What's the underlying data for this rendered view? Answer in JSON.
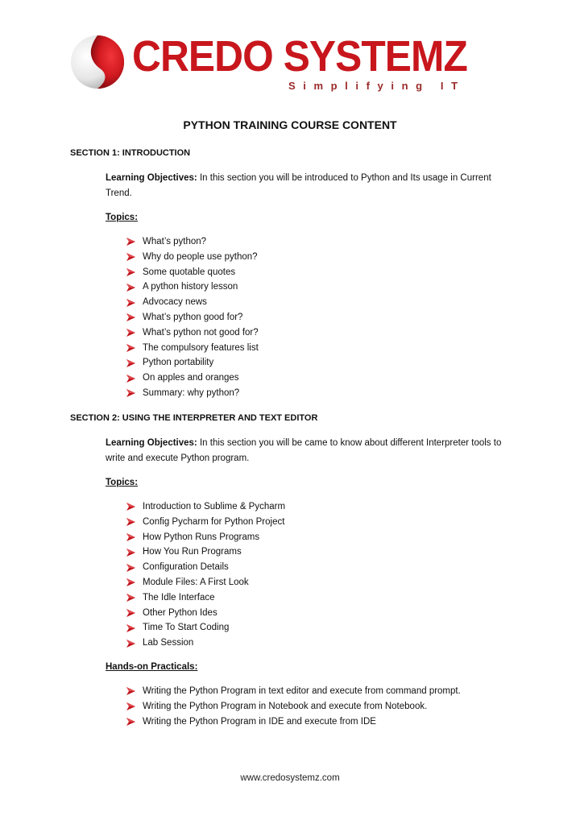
{
  "logo": {
    "brand_name": "CREDO SYSTEMZ",
    "tagline": "Simplifying IT",
    "icon": "sphere-logo-icon",
    "brand_color": "#c8161d",
    "tagline_color": "#9a2a2a"
  },
  "document": {
    "title": "PYTHON TRAINING COURSE CONTENT",
    "bullet_icon": "arrowhead-bullet-icon",
    "bullet_color": "#c0141c"
  },
  "sections": [
    {
      "heading": "SECTION 1: INTRODUCTION",
      "objective_label": "Learning Objectives:",
      "objective_text": " In this section you will be introduced to Python and Its usage in Current Trend.",
      "topics_label": "Topics:",
      "topics": [
        "What’s python?",
        "Why do people use python?",
        "Some quotable quotes",
        "A python history lesson",
        "Advocacy news",
        "What’s python good for?",
        "What’s python not good for?",
        "The compulsory features list",
        "Python portability",
        "On apples and oranges",
        "Summary: why python?"
      ]
    },
    {
      "heading": "SECTION 2: USING THE INTERPRETER AND TEXT EDITOR",
      "objective_label": "Learning Objectives:",
      "objective_text": " In this section you will be came to know about different Interpreter tools to write and execute Python program.",
      "topics_label": "Topics:",
      "topics": [
        "Introduction to Sublime & Pycharm",
        "Config Pycharm for Python Project",
        "How Python Runs Programs",
        "How You Run Programs",
        "Configuration Details",
        "Module Files: A First Look",
        "The Idle Interface",
        "Other Python Ides",
        "Time To Start Coding",
        "Lab Session"
      ],
      "practicals_label": "Hands-on Practicals:",
      "practicals": [
        "Writing the Python Program in text editor and execute from command prompt.",
        "Writing the Python Program in Notebook and execute from Notebook.",
        "Writing the Python Program in IDE and execute from IDE"
      ]
    }
  ],
  "footer": {
    "website": "www.credosystemz.com"
  }
}
